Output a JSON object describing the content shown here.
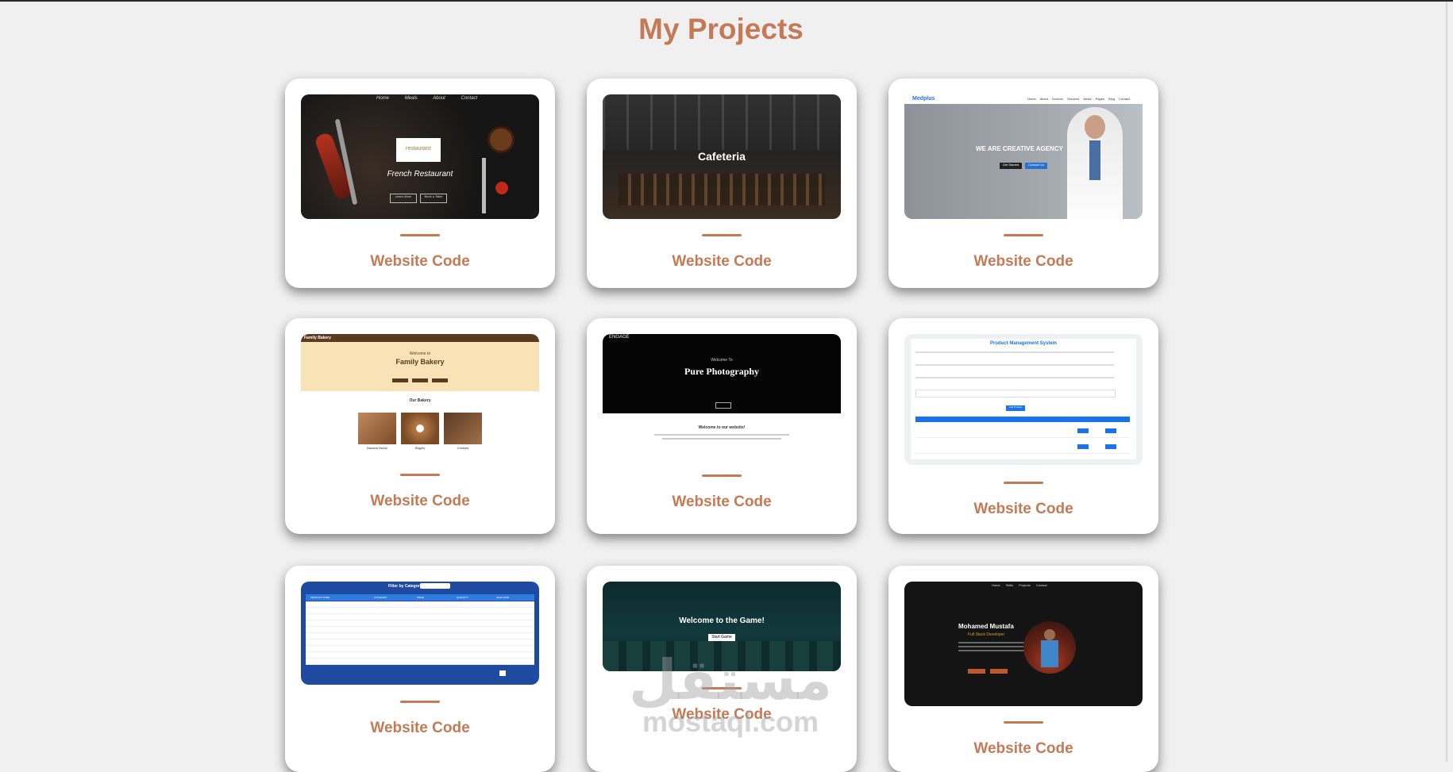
{
  "page": {
    "title": "My Projects"
  },
  "cards": [
    {
      "link_label": "Website Code",
      "preview": {
        "nav": [
          "Home",
          "Meals",
          "About",
          "Contact"
        ],
        "brand": "restaurant",
        "heading": "French Restaurant",
        "buttons": [
          "Learn More",
          "Book a Table"
        ]
      }
    },
    {
      "link_label": "Website Code",
      "preview": {
        "heading": "Cafeteria"
      }
    },
    {
      "link_label": "Website Code",
      "preview": {
        "logo": "Medplus",
        "nav": [
          "Home",
          "About",
          "Doctors",
          "Services",
          "News",
          "Pages",
          "Blog",
          "Contact"
        ],
        "heading": "WE ARE CREATIVE AGENCY",
        "buttons": [
          "Get Started",
          "Contact Us"
        ]
      }
    },
    {
      "link_label": "Website Code",
      "preview": {
        "brand": "Family Bakery",
        "welcome": "Welcome to",
        "heading": "Family Bakery",
        "section": "Our Bakery",
        "items": [
          "Banana Bread",
          "Bagels",
          "Cookies"
        ]
      }
    },
    {
      "link_label": "Website Code",
      "preview": {
        "brand": "ENGAGE",
        "welcome": "Welcome To",
        "heading": "Pure Photography",
        "subheading": "Welcome to our website!"
      }
    },
    {
      "link_label": "Website Code",
      "preview": {
        "heading": "Product Management System",
        "button": "Add Product"
      }
    },
    {
      "link_label": "Website Code",
      "preview": {
        "filter_label": "Filter by Category",
        "columns": [
          "PRODUCT NAME",
          "CATEGORY",
          "PRICE",
          "QUANTITY",
          "SALE DATE"
        ]
      }
    },
    {
      "link_label": "Website Code",
      "preview": {
        "heading": "Welcome to the Game!",
        "button": "Start Game"
      }
    },
    {
      "link_label": "Website Code",
      "preview": {
        "nav": [
          "Home",
          "Skills",
          "Projects",
          "Contact"
        ],
        "name": "Mohamed Mustafa",
        "role": "Full Stack Developer"
      }
    }
  ],
  "watermark": {
    "arabic": "مستقل",
    "latin": "mostaql.com"
  },
  "colors": {
    "accent": "#c47a56",
    "background": "#f0f0f0",
    "card": "#ffffff"
  }
}
